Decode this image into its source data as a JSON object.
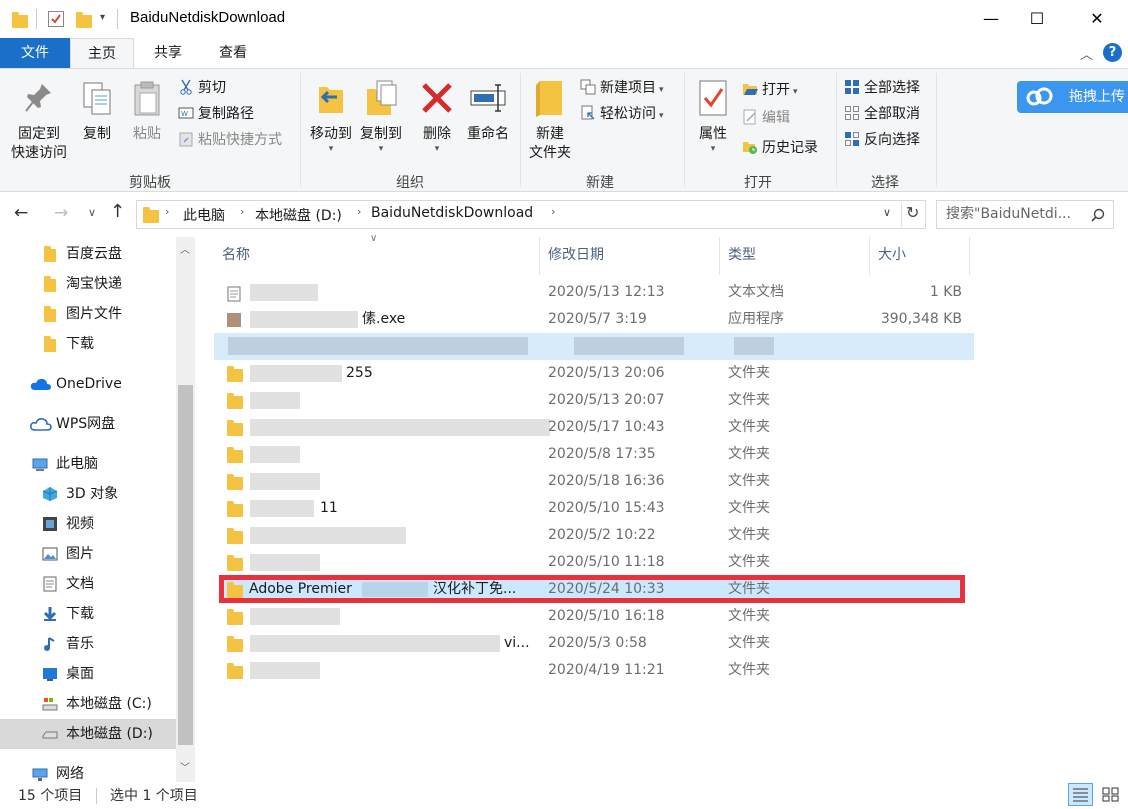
{
  "window": {
    "title": "BaiduNetdiskDownload",
    "minimize_glyph": "—",
    "maximize_glyph": "☐",
    "close_glyph": "✕"
  },
  "tabs": [
    {
      "label": "文件"
    },
    {
      "label": "主页"
    },
    {
      "label": "共享"
    },
    {
      "label": "查看"
    }
  ],
  "ribbon": {
    "clipboard": {
      "pin_l1": "固定到",
      "pin_l2": "快速访问",
      "copy": "复制",
      "paste": "粘贴",
      "cut": "剪切",
      "copy_path": "复制路径",
      "paste_shortcut": "粘贴快捷方式",
      "group": "剪贴板"
    },
    "organize": {
      "move_to": "移动到",
      "copy_to": "复制到",
      "delete": "删除",
      "rename": "重命名",
      "group": "组织"
    },
    "new": {
      "new_folder_l1": "新建",
      "new_folder_l2": "文件夹",
      "new_item": "新建项目",
      "easy_access": "轻松访问",
      "group": "新建"
    },
    "open": {
      "properties": "属性",
      "open": "打开",
      "edit": "编辑",
      "history": "历史记录",
      "group": "打开"
    },
    "select": {
      "select_all": "全部选择",
      "select_none": "全部取消",
      "invert": "反向选择",
      "group": "选择"
    },
    "baidu_upload": "拖拽上传"
  },
  "address": {
    "crumbs": [
      "此电脑",
      "本地磁盘 (D:)",
      "BaiduNetdiskDownload"
    ],
    "search_placeholder": "搜索\"BaiduNetdi..."
  },
  "nav": [
    {
      "label": "百度云盘"
    },
    {
      "label": "淘宝快递"
    },
    {
      "label": "图片文件"
    },
    {
      "label": "下载"
    },
    {
      "label": "OneDrive"
    },
    {
      "label": "WPS网盘"
    },
    {
      "label": "此电脑"
    },
    {
      "label": "3D 对象"
    },
    {
      "label": "视频"
    },
    {
      "label": "图片"
    },
    {
      "label": "文档"
    },
    {
      "label": "下载"
    },
    {
      "label": "音乐"
    },
    {
      "label": "桌面"
    },
    {
      "label": "本地磁盘 (C:)"
    },
    {
      "label": "本地磁盘 (D:)"
    },
    {
      "label": "网络"
    }
  ],
  "columns": {
    "name": "名称",
    "date": "修改日期",
    "type": "类型",
    "size": "大小"
  },
  "files": [
    {
      "name": "",
      "date": "2020/5/13 12:13",
      "type": "文本文档",
      "size": "1 KB"
    },
    {
      "name": "傃.exe",
      "date": "2020/5/7 3:19",
      "type": "应用程序",
      "size": "390,348 KB"
    },
    {
      "name": "",
      "date": "",
      "type": "",
      "size": ""
    },
    {
      "name": "255",
      "date": "2020/5/13 20:06",
      "type": "文件夹",
      "size": ""
    },
    {
      "name": "",
      "date": "2020/5/13 20:07",
      "type": "文件夹",
      "size": ""
    },
    {
      "name": "",
      "date": "2020/5/17 10:43",
      "type": "文件夹",
      "size": ""
    },
    {
      "name": "",
      "date": "2020/5/8 17:35",
      "type": "文件夹",
      "size": ""
    },
    {
      "name": "",
      "date": "2020/5/18 16:36",
      "type": "文件夹",
      "size": ""
    },
    {
      "name": "11",
      "date": "2020/5/10 15:43",
      "type": "文件夹",
      "size": ""
    },
    {
      "name": "",
      "date": "2020/5/2 10:22",
      "type": "文件夹",
      "size": ""
    },
    {
      "name": "",
      "date": "2020/5/10 11:18",
      "type": "文件夹",
      "size": ""
    },
    {
      "name": "Adobe Premier",
      "name_suffix": "汉化补丁免...",
      "date": "2020/5/24 10:33",
      "type": "文件夹",
      "size": ""
    },
    {
      "name": "",
      "date": "2020/5/10 16:18",
      "type": "文件夹",
      "size": ""
    },
    {
      "name": "vi...",
      "date": "2020/5/3 0:58",
      "type": "文件夹",
      "size": ""
    },
    {
      "name": "",
      "date": "2020/4/19 11:21",
      "type": "文件夹",
      "size": ""
    }
  ],
  "status": {
    "count": "15 个项目",
    "selected": "选中 1 个项目"
  },
  "colors": {
    "accent": "#1a6fc9",
    "highlight": "#cce8ff",
    "red_box": "#e8313a",
    "folder": "#f5c342"
  }
}
